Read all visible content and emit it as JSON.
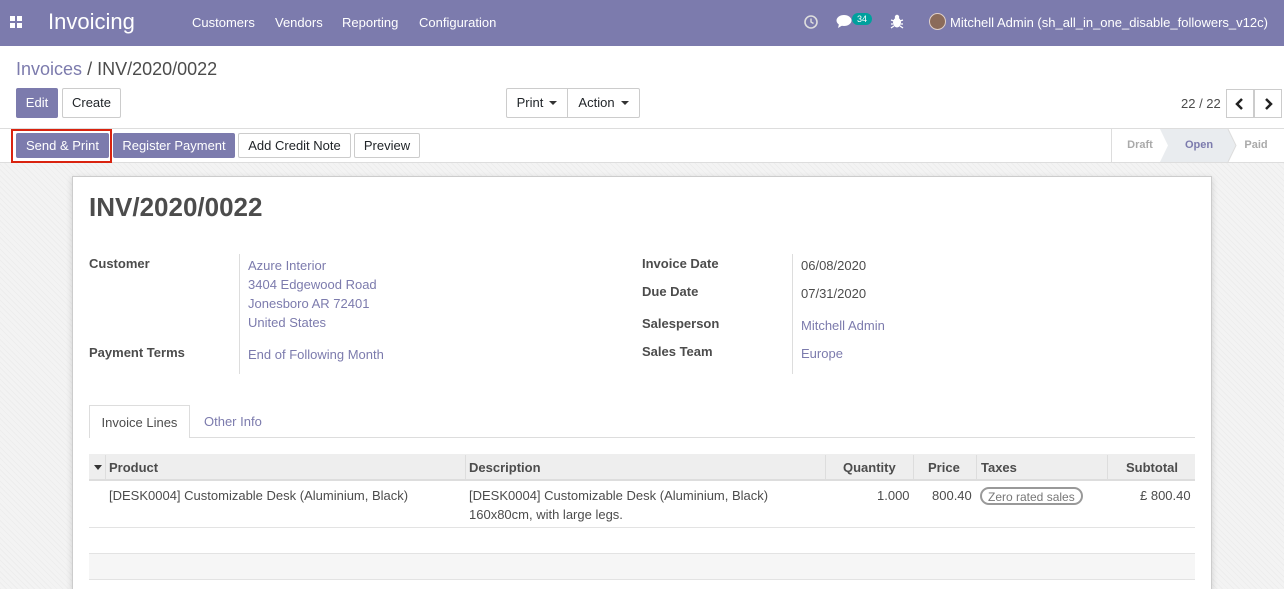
{
  "navbar": {
    "brand": "Invoicing",
    "menu": [
      "Customers",
      "Vendors",
      "Reporting",
      "Configuration"
    ],
    "message_count": "34",
    "user": "Mitchell Admin (sh_all_in_one_disable_followers_v12c)"
  },
  "breadcrumb": {
    "parent": "Invoices",
    "separator": "/",
    "current": "INV/2020/0022"
  },
  "buttons": {
    "edit": "Edit",
    "create": "Create",
    "print": "Print",
    "action": "Action"
  },
  "pager": {
    "value": "22 / 22"
  },
  "statusbar": {
    "send_print": "Send & Print",
    "register_payment": "Register Payment",
    "add_credit_note": "Add Credit Note",
    "preview": "Preview",
    "stages": [
      "Draft",
      "Open",
      "Paid"
    ],
    "active_stage": "Open"
  },
  "invoice": {
    "number": "INV/2020/0022",
    "customer_label": "Customer",
    "customer_name": "Azure Interior",
    "customer_address": [
      "3404 Edgewood Road",
      "Jonesboro AR 72401",
      "United States"
    ],
    "payment_terms_label": "Payment Terms",
    "payment_terms": "End of Following Month",
    "invoice_date_label": "Invoice Date",
    "invoice_date": "06/08/2020",
    "due_date_label": "Due Date",
    "due_date": "07/31/2020",
    "salesperson_label": "Salesperson",
    "salesperson": "Mitchell Admin",
    "sales_team_label": "Sales Team",
    "sales_team": "Europe"
  },
  "tabs": [
    "Invoice Lines",
    "Other Info"
  ],
  "table": {
    "columns": [
      "Product",
      "Description",
      "Quantity",
      "Price",
      "Taxes",
      "Subtotal"
    ],
    "rows": [
      {
        "product": "[DESK0004] Customizable Desk (Aluminium, Black)",
        "description": [
          "[DESK0004] Customizable Desk (Aluminium, Black)",
          "160x80cm, with large legs."
        ],
        "quantity": "1.000",
        "price": "800.40",
        "taxes": "Zero rated sales",
        "subtotal": "£ 800.40"
      }
    ]
  },
  "colors": {
    "brand": "#7c7bad",
    "highlight": "#d9230f",
    "badge": "#00a09d"
  },
  "icons": [
    "apps-icon",
    "clock-icon",
    "chat-icon",
    "bug-icon",
    "chevron-left-icon",
    "chevron-right-icon",
    "caret-down-icon"
  ]
}
